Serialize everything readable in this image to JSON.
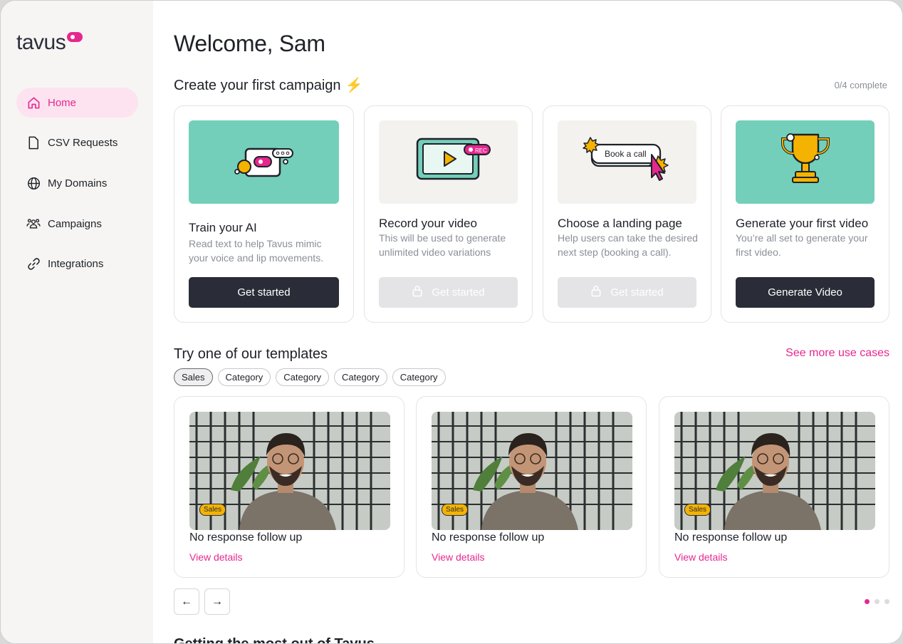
{
  "brand": {
    "name": "tavus",
    "accent": "#e5288f"
  },
  "sidebar": {
    "items": [
      {
        "label": "Home",
        "icon": "home-icon",
        "active": true
      },
      {
        "label": "CSV Requests",
        "icon": "file-icon",
        "active": false
      },
      {
        "label": "My Domains",
        "icon": "globe-icon",
        "active": false
      },
      {
        "label": "Campaigns",
        "icon": "users-icon",
        "active": false
      },
      {
        "label": "Integrations",
        "icon": "link-icon",
        "active": false
      }
    ]
  },
  "header": {
    "welcome": "Welcome, Sam"
  },
  "campaign": {
    "title": "Create your first campaign",
    "progress": "0/4 complete",
    "steps": [
      {
        "title": "Train your AI",
        "desc_line1": "Read text to help Tavus mimic",
        "desc_line2": "your voice and lip movements.",
        "button": "Get started",
        "enabled": true
      },
      {
        "title": "Record your video",
        "desc_line1": "This will be used to generate",
        "desc_line2": "unlimited video variations",
        "button": "Get started",
        "enabled": false,
        "badge": "REC"
      },
      {
        "title": "Choose a landing page",
        "desc_line1": "Help users can take the desired",
        "desc_line2": "next step (booking a call).",
        "button": "Get started",
        "enabled": false,
        "illustration_text": "Book a call"
      },
      {
        "title": "Generate your first video",
        "desc_line1": "You’re all set to generate your",
        "desc_line2": "first video.",
        "button": "Generate Video",
        "enabled": true
      }
    ]
  },
  "templates": {
    "title": "Try one of our templates",
    "see_more": "See more use cases",
    "chips": [
      "Sales",
      "Category",
      "Category",
      "Category",
      "Category"
    ],
    "active_chip": "Sales",
    "cards": [
      {
        "tag": "Sales",
        "title": "No response follow up",
        "link": "View details"
      },
      {
        "tag": "Sales",
        "title": "No response follow up",
        "link": "View details"
      },
      {
        "tag": "Sales",
        "title": "No response follow up",
        "link": "View details"
      }
    ],
    "prev_label": "←",
    "next_label": "→",
    "page_count": 3,
    "current_page": 1
  },
  "footer_section": {
    "title": "Getting the most out of Tavus"
  }
}
